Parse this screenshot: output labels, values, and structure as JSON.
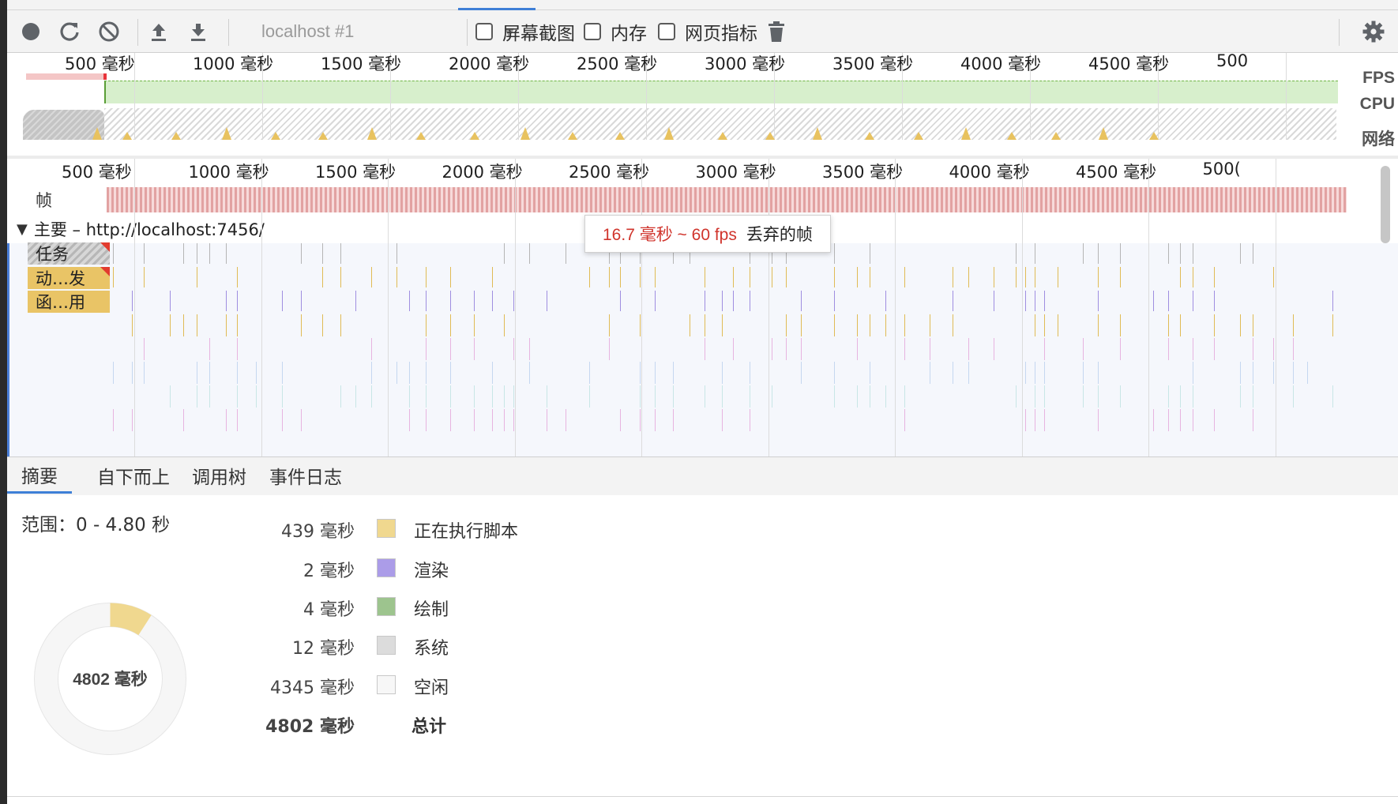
{
  "toolbar": {
    "target": "localhost #1",
    "screenshots_label": "屏幕截图",
    "memory_label": "内存",
    "web_vitals_label": "网页指标",
    "icons": [
      "record-icon",
      "reload-icon",
      "clear-icon",
      "upload-icon",
      "download-icon",
      "trash-icon",
      "settings-icon"
    ]
  },
  "overview": {
    "ruler": [
      "500 毫秒",
      "1000 毫秒",
      "1500 毫秒",
      "2000 毫秒",
      "2500 毫秒",
      "3000 毫秒",
      "3500 毫秒",
      "4000 毫秒",
      "4500 毫秒",
      "500"
    ],
    "fps_label": "FPS",
    "cpu_label": "CPU",
    "network_label": "网络"
  },
  "flame": {
    "ruler": [
      "500 毫秒",
      "1000 毫秒",
      "1500 毫秒",
      "2000 毫秒",
      "2500 毫秒",
      "3000 毫秒",
      "3500 毫秒",
      "4000 毫秒",
      "4500 毫秒",
      "500("
    ],
    "frames_label": "帧",
    "main_title": "主要 – http://localhost:7456/",
    "tracks": {
      "task": "任务",
      "animation": "动…发",
      "function": "函…用"
    }
  },
  "tooltip": {
    "duration": "16.7 毫秒 ~ 60 fps",
    "status": "丢弃的帧"
  },
  "tabs": [
    "摘要",
    "自下而上",
    "调用树",
    "事件日志"
  ],
  "summary": {
    "range": "范围：0 - 4.80 秒",
    "total_center": "4802 毫秒",
    "items": [
      {
        "value": "439 毫秒",
        "label": "正在执行脚本",
        "color": "#f0d88f"
      },
      {
        "value": "2 毫秒",
        "label": "渲染",
        "color": "#ab9ce8"
      },
      {
        "value": "4 毫秒",
        "label": "绘制",
        "color": "#9dc48e"
      },
      {
        "value": "12 毫秒",
        "label": "系统",
        "color": "#dcdcdc"
      },
      {
        "value": "4345 毫秒",
        "label": "空闲",
        "color": "#f7f7f7"
      }
    ],
    "total": {
      "value": "4802 毫秒",
      "label": "总计"
    }
  }
}
